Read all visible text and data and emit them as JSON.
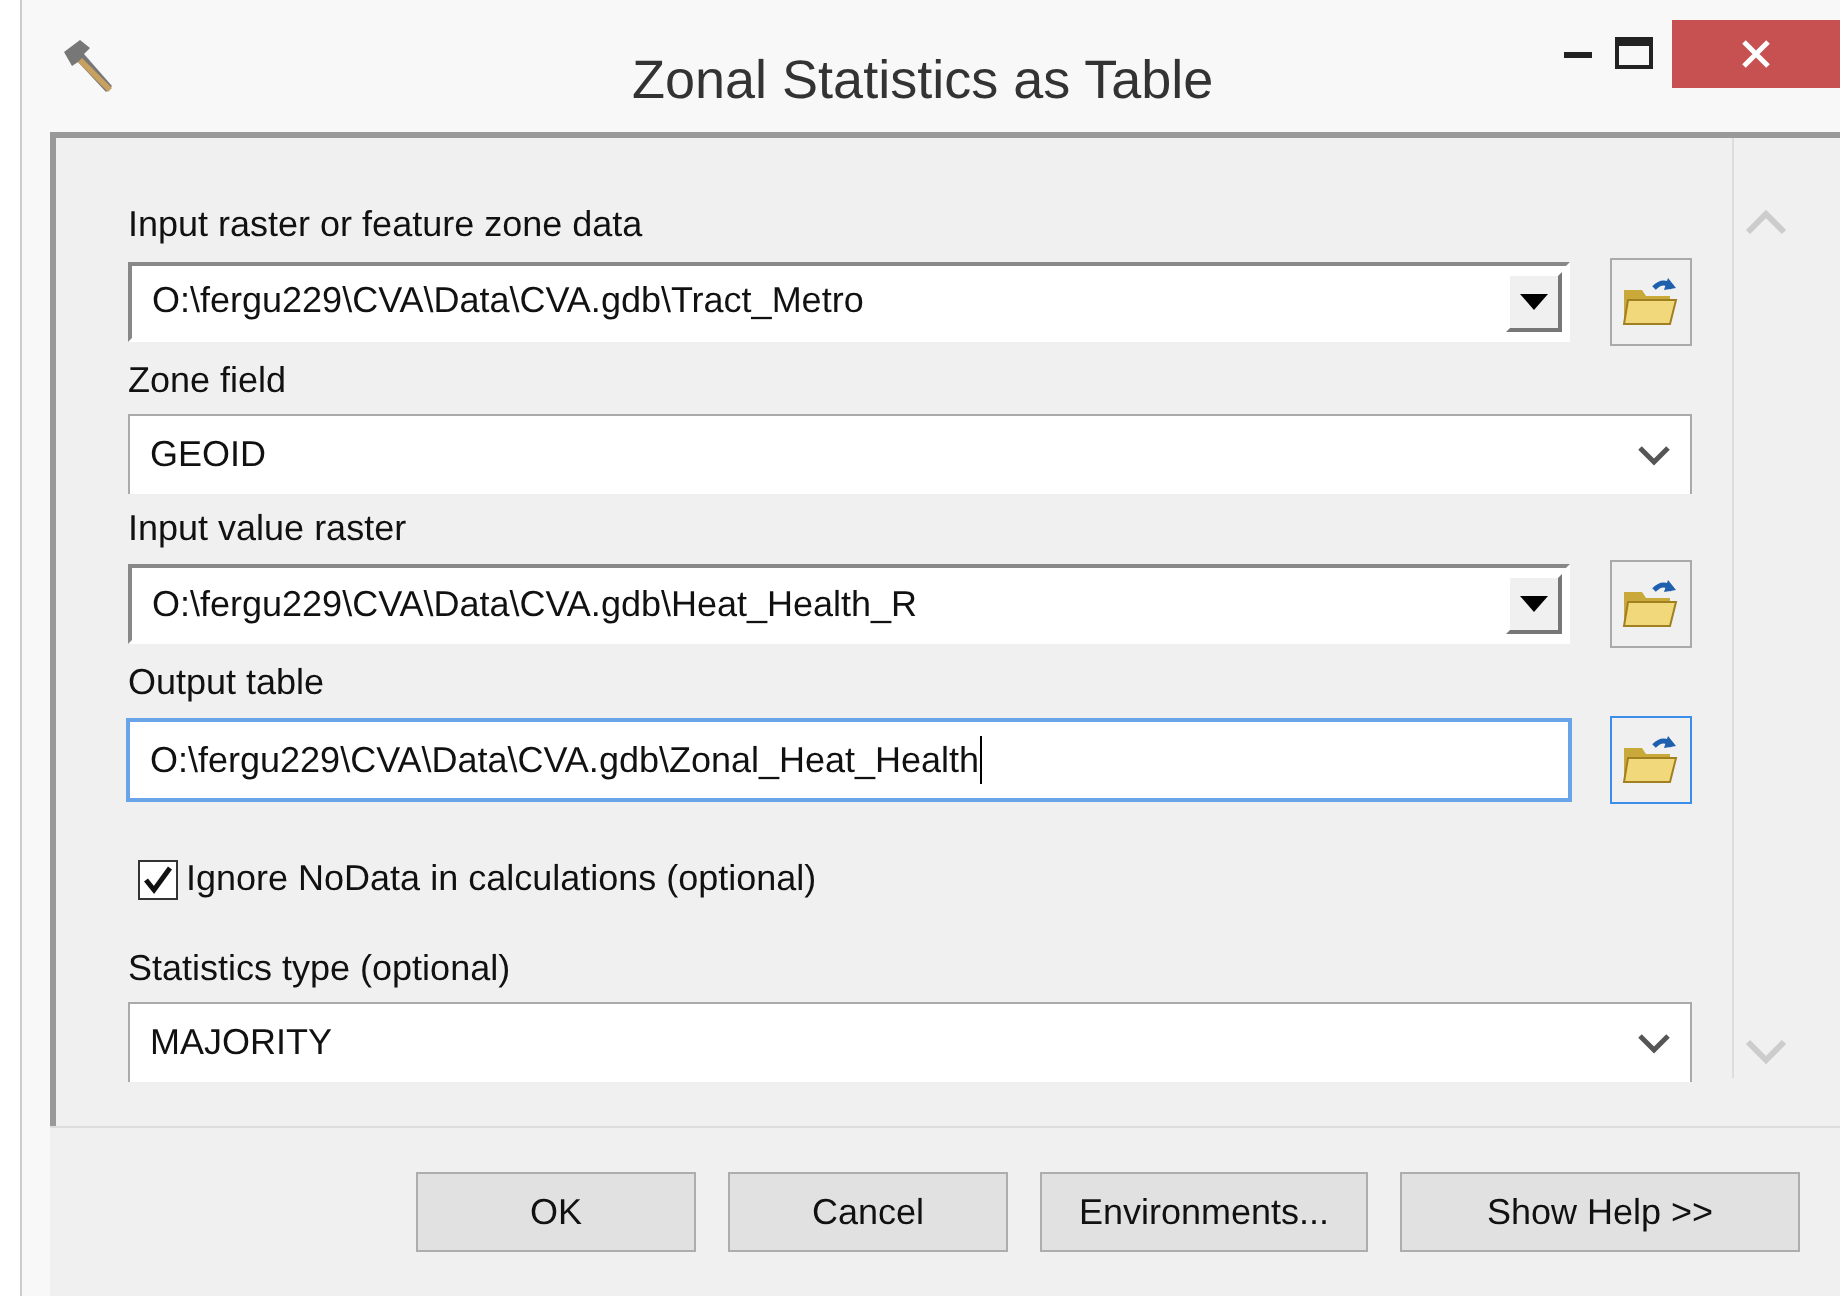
{
  "window": {
    "title": "Zonal Statistics as Table"
  },
  "parameters": [
    {
      "kind": "combo",
      "label": "Input raster or feature zone data",
      "value": "O:\\fergu229\\CVA\\Data\\CVA.gdb\\Tract_Metro",
      "focused": false
    },
    {
      "kind": "select",
      "label": "Zone field",
      "value": "GEOID",
      "focused": false
    },
    {
      "kind": "combo",
      "label": "Input value raster",
      "value": "O:\\fergu229\\CVA\\Data\\CVA.gdb\\Heat_Health_R",
      "focused": false
    },
    {
      "kind": "text",
      "label": "Output table",
      "value": "O:\\fergu229\\CVA\\Data\\CVA.gdb\\Zonal_Heat_Health",
      "focused": true
    },
    {
      "kind": "checkbox",
      "label": "Ignore NoData in calculations (optional)",
      "checked": true
    },
    {
      "kind": "select",
      "label": "Statistics type (optional)",
      "value": "MAJORITY",
      "focused": false
    }
  ],
  "buttons": [
    "OK",
    "Cancel",
    "Environments...",
    "Show Help >>"
  ]
}
